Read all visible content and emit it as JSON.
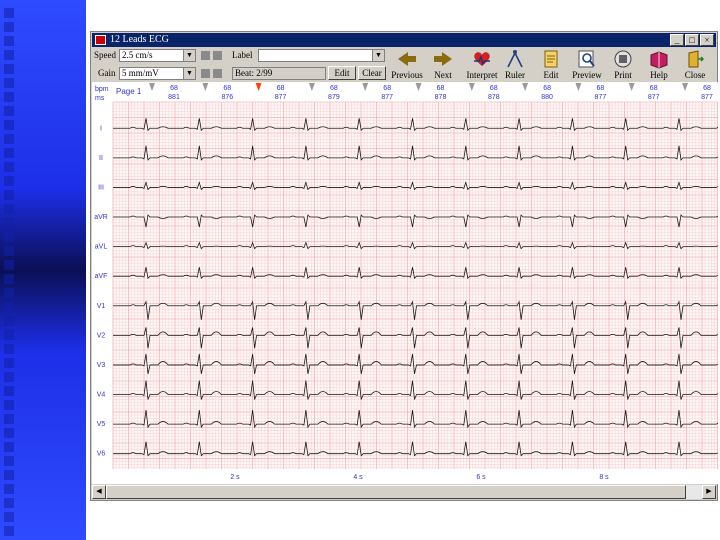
{
  "window": {
    "title": "12 Leads ECG"
  },
  "controls": {
    "speed_label": "Speed",
    "speed_value": "2.5 cm/s",
    "gain_label": "Gain",
    "gain_value": "5 mm/mV",
    "label_label": "Label",
    "label_value": "",
    "beat_value": "Beat: 2/99",
    "edit_label": "Edit",
    "clear_label": "Clear"
  },
  "tools": [
    {
      "label": "Previous",
      "icon": "arrow-left-icon"
    },
    {
      "label": "Next",
      "icon": "arrow-right-icon"
    },
    {
      "label": "Interpret",
      "icon": "heart-icon"
    },
    {
      "label": "Ruler",
      "icon": "compass-icon"
    },
    {
      "label": "Edit",
      "icon": "notepad-icon"
    },
    {
      "label": "Preview",
      "icon": "magnifier-icon"
    },
    {
      "label": "Print",
      "icon": "printer-icon"
    },
    {
      "label": "Help",
      "icon": "book-icon"
    },
    {
      "label": "Close",
      "icon": "door-icon"
    }
  ],
  "header": {
    "row_labels": [
      "bpm",
      "ms"
    ],
    "page_label": "Page 1",
    "beats": [
      {
        "bpm": "68",
        "ms": "881"
      },
      {
        "bpm": "68",
        "ms": "876"
      },
      {
        "bpm": "68",
        "ms": "877"
      },
      {
        "bpm": "68",
        "ms": "879"
      },
      {
        "bpm": "68",
        "ms": "877"
      },
      {
        "bpm": "68",
        "ms": "878"
      },
      {
        "bpm": "68",
        "ms": "878"
      },
      {
        "bpm": "68",
        "ms": "880"
      },
      {
        "bpm": "68",
        "ms": "877"
      },
      {
        "bpm": "68",
        "ms": "877"
      },
      {
        "bpm": "68",
        "ms": "877"
      }
    ]
  },
  "leads": [
    "I",
    "II",
    "III",
    "aVR",
    "aVL",
    "aVF",
    "V1",
    "V2",
    "V3",
    "V4",
    "V5",
    "V6"
  ],
  "time_marks": [
    "2 s",
    "4 s",
    "6 s",
    "8 s"
  ],
  "colors": {
    "grid_minor": "#f6c8c8",
    "grid_major": "#ec9a9a",
    "trace": "#1a1a1a",
    "label_blue": "#3333cc",
    "marker_active": "#ff4400"
  }
}
